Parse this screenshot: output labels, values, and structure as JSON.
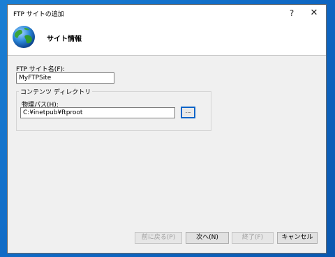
{
  "window": {
    "title": "FTP サイトの追加",
    "help_glyph": "?",
    "close_glyph": "✕"
  },
  "header": {
    "title": "サイト情報",
    "icon": "globe-icon"
  },
  "form": {
    "site_name_label": "FTP サイト名(F):",
    "site_name_value": "MyFTPSite",
    "content_dir_group": "コンテンツ ディレクトリ",
    "physical_path_label": "物理パス(H):",
    "physical_path_value": "C:¥inetpub¥ftproot",
    "browse_label": "..."
  },
  "buttons": {
    "back": "前に戻る(P)",
    "next": "次へ(N)",
    "finish": "終了(F)",
    "cancel": "キャンセル"
  },
  "colors": {
    "desktop": "#0e66c2",
    "focus_border": "#0a64c8"
  }
}
